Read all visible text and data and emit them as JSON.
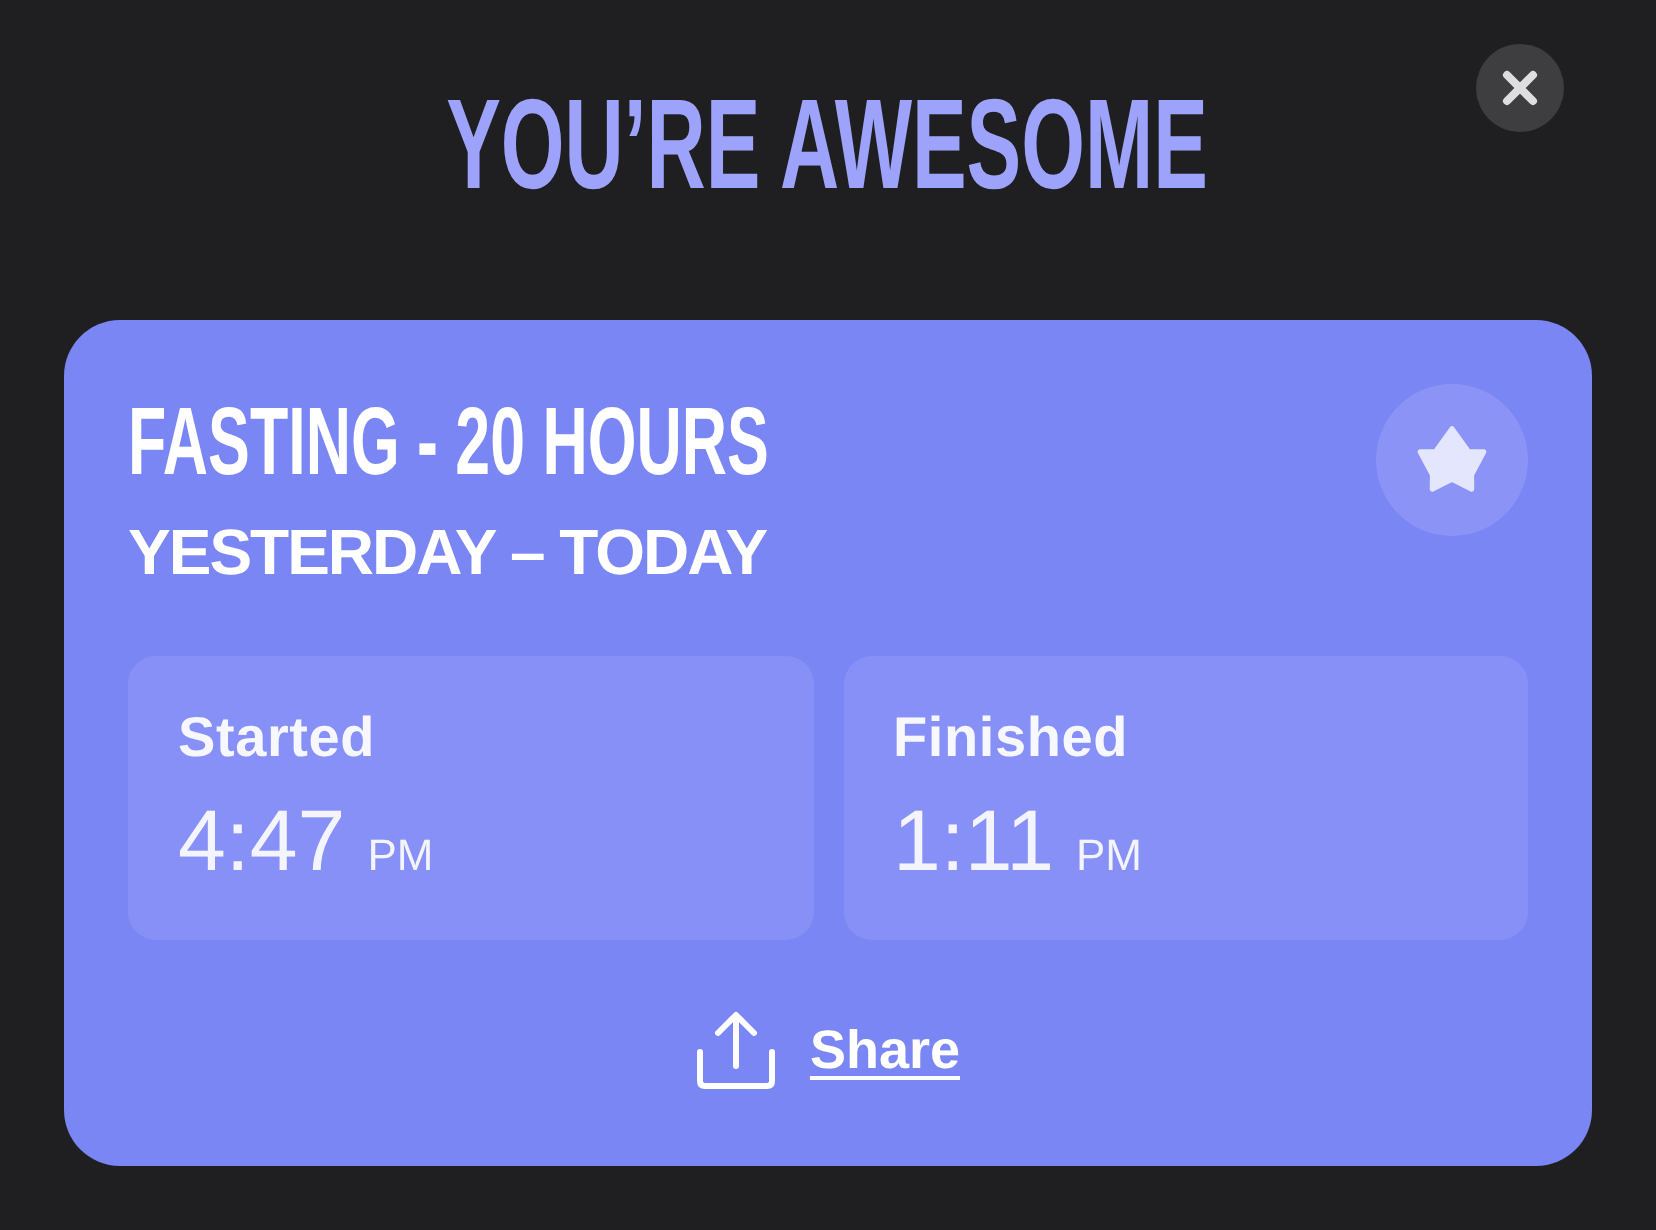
{
  "title": "YOU’RE AWESOME",
  "card": {
    "heading": "FASTING - 20 HOURS",
    "subheading": "YESTERDAY – TODAY",
    "times": [
      {
        "label": "Started",
        "time": "4:47",
        "period": "PM"
      },
      {
        "label": "Finished",
        "time": "1:11",
        "period": "PM"
      }
    ],
    "share": {
      "label": "Share"
    }
  }
}
